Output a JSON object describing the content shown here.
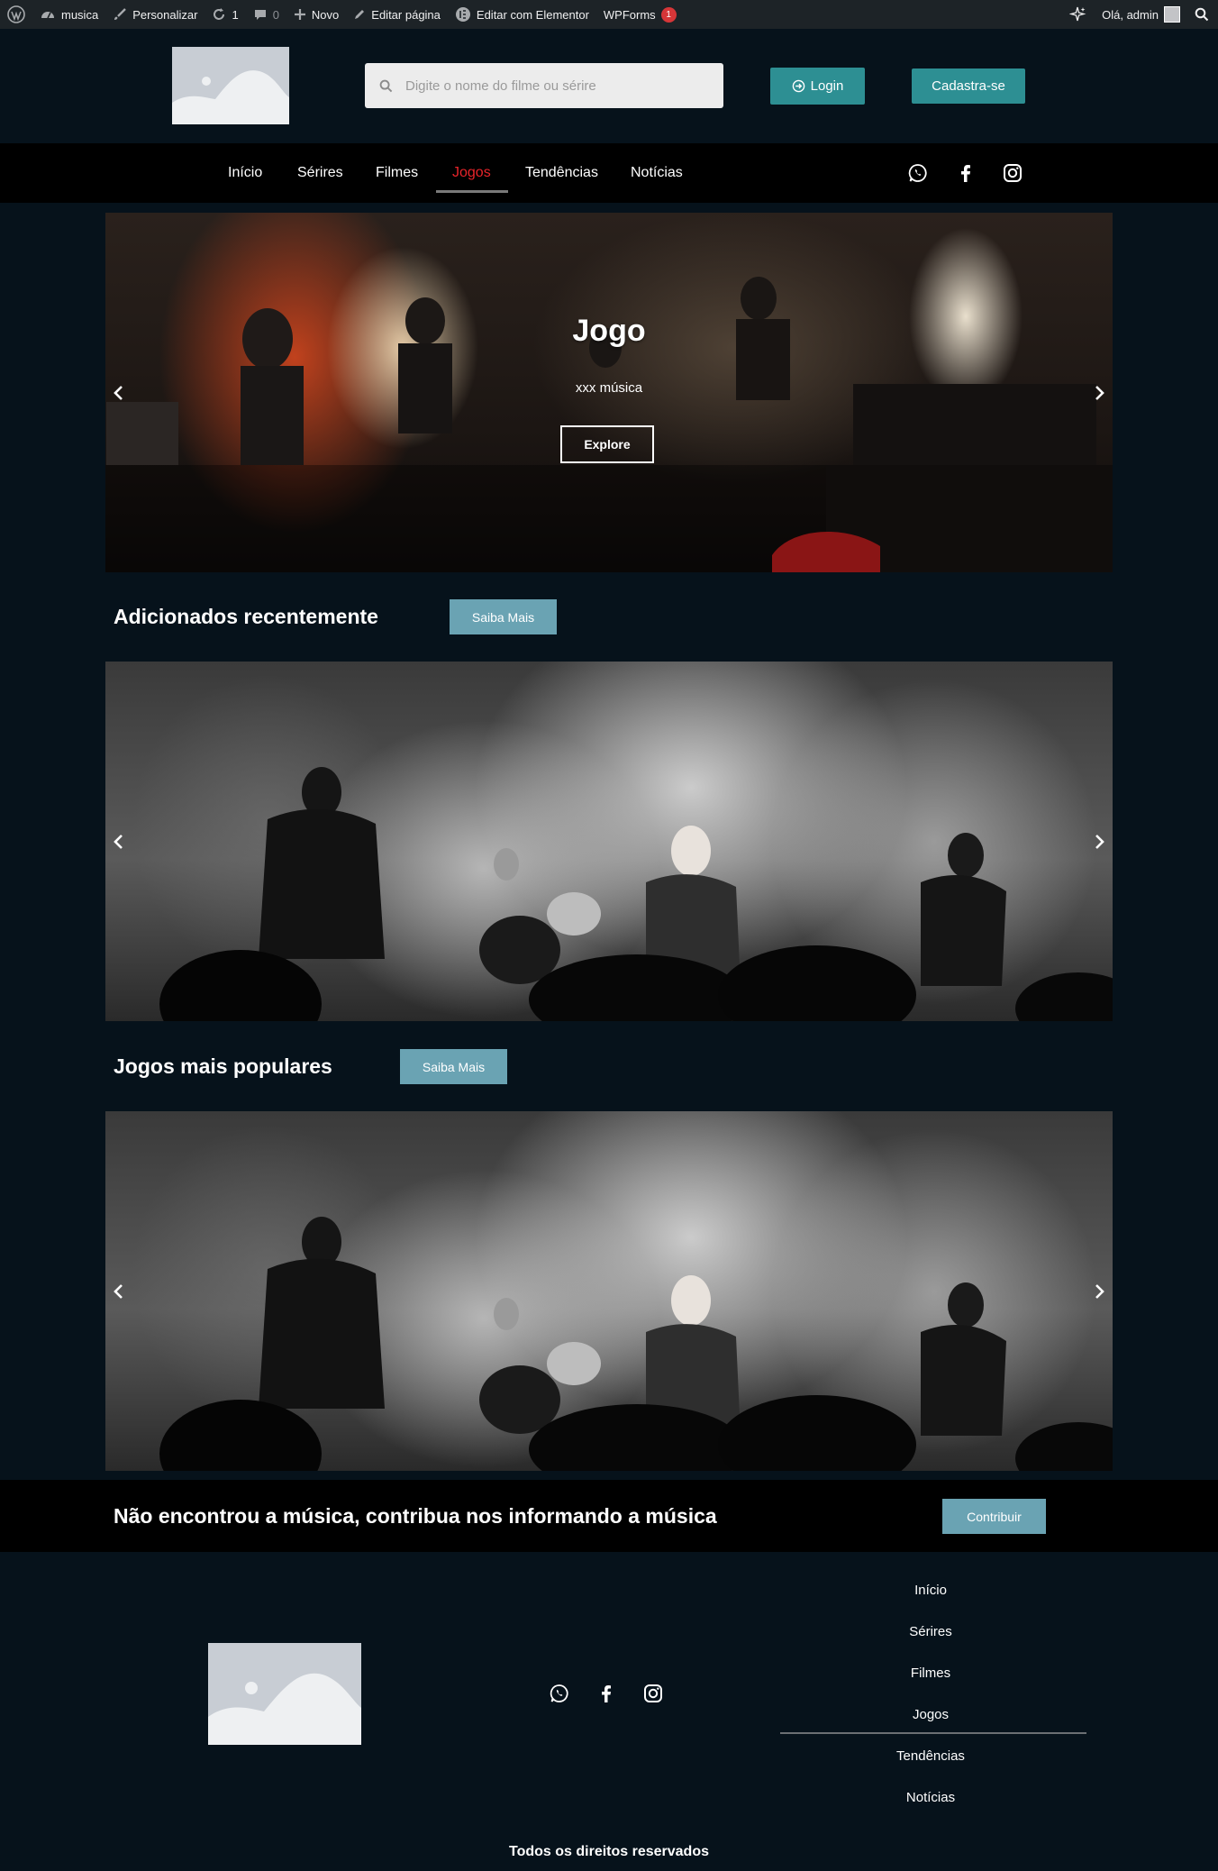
{
  "adminbar": {
    "site": "musica",
    "customize": "Personalizar",
    "updates_count": "1",
    "comments_count": "0",
    "new": "Novo",
    "edit_page": "Editar página",
    "edit_elementor": "Editar com Elementor",
    "wpforms": "WPForms",
    "wpforms_badge": "1",
    "greeting": "Olá, admin"
  },
  "header": {
    "search_placeholder": "Digite o nome do filme ou sérire",
    "login": "Login",
    "register": "Cadastra-se"
  },
  "nav": {
    "items": [
      "Início",
      "Sérires",
      "Filmes",
      "Jogos",
      "Tendências",
      "Notícias"
    ],
    "active_index": 3,
    "active_color": "#e8242a"
  },
  "hero": {
    "title": "Jogo",
    "subtitle": "xxx música",
    "button": "Explore"
  },
  "sections": [
    {
      "title": "Adicionados recentemente",
      "button": "Saiba Mais"
    },
    {
      "title": "Jogos mais populares",
      "button": "Saiba Mais"
    }
  ],
  "contribute": {
    "text": "Não encontrou a música, contribua nos informando a música",
    "button": "Contribuir"
  },
  "footer": {
    "menu": [
      "Início",
      "Sérires",
      "Filmes",
      "Jogos",
      "Tendências",
      "Notícias"
    ],
    "copyright": "Todos os direitos reservados"
  },
  "icons": [
    "wordpress-icon",
    "dashboard-icon",
    "brush-icon",
    "refresh-icon",
    "comment-icon",
    "plus-icon",
    "pencil-icon",
    "elementor-icon",
    "sparkle-icon",
    "search-icon",
    "login-icon",
    "whatsapp-icon",
    "facebook-icon",
    "instagram-icon",
    "chevron-left-icon",
    "chevron-right-icon"
  ],
  "colors": {
    "accent": "#2d8f93",
    "button_soft": "#6aa3b3",
    "background": "#06121b"
  }
}
